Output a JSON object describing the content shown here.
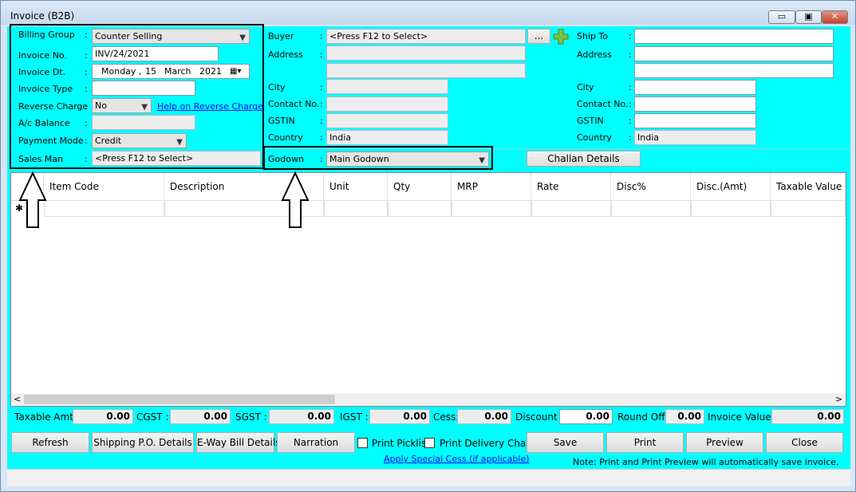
{
  "window": {
    "title": "Invoice (B2B)",
    "min_symbol": "▭",
    "max_symbol": "▣",
    "close_symbol": "✕"
  },
  "left": {
    "billing_group": {
      "label": "Billing Group",
      "value": "Counter Selling"
    },
    "invoice_no": {
      "label": "Invoice No.",
      "value": "INV/24/2021"
    },
    "invoice_dt": {
      "label": "Invoice Dt.",
      "day": "Monday",
      "date": "15",
      "month": "March",
      "year": "2021"
    },
    "invoice_type": {
      "label": "Invoice Type",
      "value": ""
    },
    "reverse_charge": {
      "label": "Reverse Charge",
      "value": "No",
      "help_link": "Help on Reverse Charge"
    },
    "ac_balance": {
      "label": "A/c Balance",
      "value": ""
    },
    "payment_mode": {
      "label": "Payment Mode",
      "value": "Credit"
    },
    "sales_man": {
      "label": "Sales Man",
      "value": "<Press F12 to Select>"
    }
  },
  "buyer": {
    "buyer": {
      "label": "Buyer",
      "value": "<Press F12 to Select>",
      "browse": "...",
      "add_icon": "plus-icon"
    },
    "address": {
      "label": "Address"
    },
    "city": {
      "label": "City"
    },
    "contact": {
      "label": "Contact No."
    },
    "gstin": {
      "label": "GSTIN"
    },
    "country": {
      "label": "Country",
      "value": "India"
    },
    "godown": {
      "label": "Godown",
      "value": "Main Godown"
    },
    "challan_button": "Challan Details"
  },
  "ship": {
    "ship_to": {
      "label": "Ship To"
    },
    "address": {
      "label": "Address"
    },
    "city": {
      "label": "City"
    },
    "contact": {
      "label": "Contact No."
    },
    "gstin": {
      "label": "GSTIN"
    },
    "country": {
      "label": "Country",
      "value": "India"
    }
  },
  "grid": {
    "columns": [
      "Item Code",
      "Description",
      "Unit",
      "Qty",
      "MRP",
      "Rate",
      "Disc%",
      "Disc.(Amt)",
      "Taxable Value"
    ],
    "new_row_marker": "✱"
  },
  "totals": {
    "taxable_amt": {
      "label": "Taxable Amt. :",
      "value": "0.00"
    },
    "cgst": {
      "label": "CGST :",
      "value": "0.00"
    },
    "sgst": {
      "label": "SGST :",
      "value": "0.00"
    },
    "igst": {
      "label": "IGST :",
      "value": "0.00"
    },
    "cess": {
      "label": "Cess:",
      "value": "0.00"
    },
    "discount": {
      "label": "Discount :",
      "value": "0.00"
    },
    "round_off": {
      "label": "Round Off :",
      "value": "0.00"
    },
    "invoice_value": {
      "label": "Invoice Value :",
      "value": "0.00"
    }
  },
  "buttons": {
    "refresh": "Refresh",
    "shipping": "Shipping P.O. Details",
    "eway": "E-Way Bill Details",
    "narration": "Narration",
    "print_picklist": "Print Picklist",
    "print_delivery": "Print Delivery Challan",
    "save": "Save",
    "print": "Print",
    "preview": "Preview",
    "close": "Close"
  },
  "special_cess_link": "Apply Special Cess (if applicable)",
  "note": "Note: Print and Print Preview will automatically save invoice."
}
